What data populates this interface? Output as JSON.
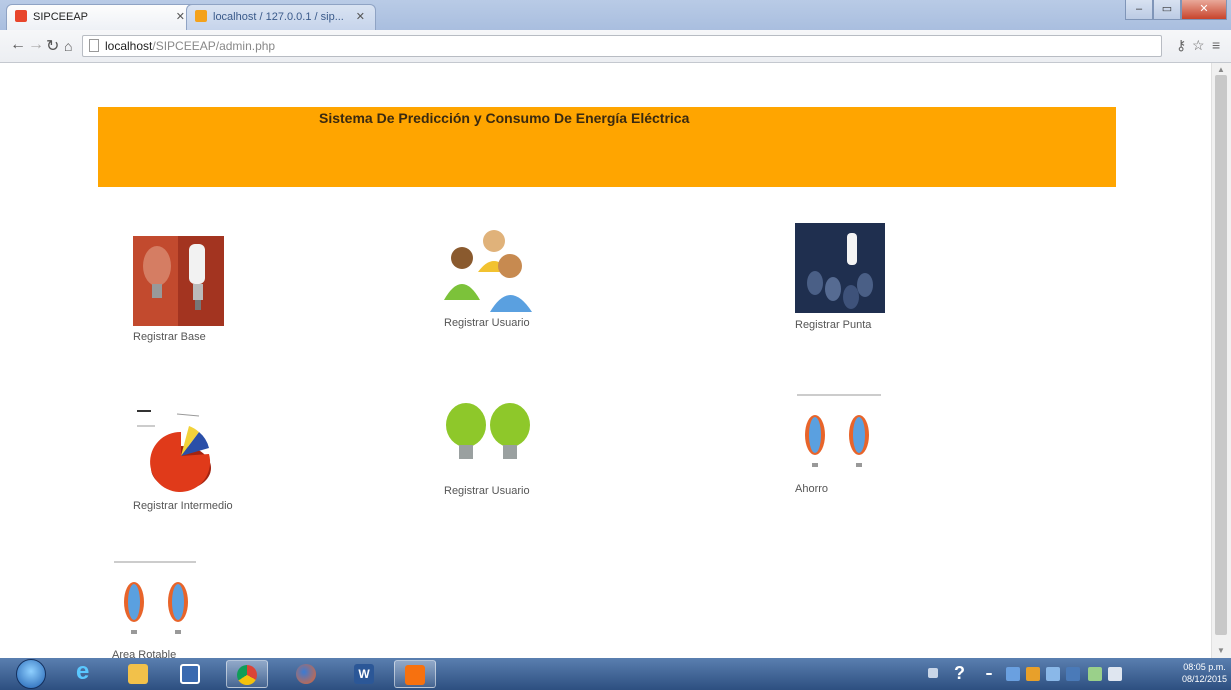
{
  "browser": {
    "tabs": [
      {
        "title": "SIPCEEAP"
      },
      {
        "title": "localhost / 127.0.0.1 / sip..."
      }
    ],
    "url_host": "localhost",
    "url_path": "/SIPCEEAP/admin.php"
  },
  "page": {
    "title": "Sistema De Predicción y Consumo De Energía Eléctrica",
    "items": [
      {
        "label": "Registrar Base"
      },
      {
        "label": "Registrar Usuario"
      },
      {
        "label": "Registrar Punta"
      },
      {
        "label": "Registrar Intermedio"
      },
      {
        "label": "Registrar Usuario"
      },
      {
        "label": "Ahorro"
      },
      {
        "label": "Area Rotable"
      }
    ]
  },
  "taskbar": {
    "clock_time": "08:05 p.m.",
    "clock_date": "08/12/2015"
  },
  "colors": {
    "banner": "#ffa500"
  }
}
